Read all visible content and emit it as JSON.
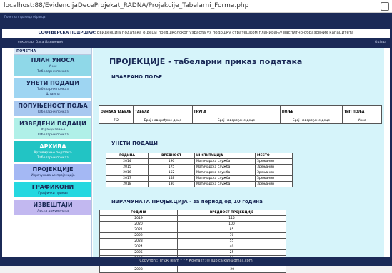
{
  "browser": {
    "url": "localhost:88/EvidencijaDeceProjekat_RADNA/Projekcije_Tabelarni_Forma.php"
  },
  "top": {
    "link": "Почетна страница обрасца"
  },
  "header": {
    "bold": "СОФТВЕРСКА ПОДРШКА:",
    "text": " Евиденција података о деци предшколског узраста уз подршку стратешком планирању васпитно-образовних капацитета"
  },
  "darkbar": {
    "user": "секретар: Олга Лазаревић",
    "logout": "Одјава"
  },
  "sidebar": {
    "home": "ПОЧЕТНА",
    "sections": [
      {
        "title": "ПЛАН УНОСА",
        "items": [
          "Унос",
          "Табеларни приказ"
        ]
      },
      {
        "title": "УНЕТИ ПОДАЦИ",
        "items": [
          "Табеларни приказ",
          "Штампа"
        ]
      },
      {
        "title": "ПОПУЊЕНОСТ ПОЉА",
        "items": [
          "Табеларни приказ"
        ]
      },
      {
        "title": "ИЗВЕДЕНИ ПОДАЦИ",
        "items": [
          "Израчунавање",
          "Табеларни приказ"
        ]
      },
      {
        "title": "АРХИВА",
        "items": [
          "Архивирање података",
          "Табеларни приказ"
        ]
      },
      {
        "title": "ПРОЈЕКЦИЈЕ",
        "items": [
          "Израчунавање пројекција"
        ]
      },
      {
        "title": "ГРАФИКОНИ",
        "items": [
          "Графички приказ"
        ]
      },
      {
        "title": "ИЗВЕШТАЈИ",
        "items": [
          "Листа докумената"
        ]
      }
    ]
  },
  "main": {
    "title": "ПРОЈЕКЦИЈЕ - табеларни приказ података",
    "selected_heading": "ИЗАБРАНО ПОЉЕ",
    "selected_table": {
      "headers": [
        "ОЗНАКА ТАБЕЛЕ",
        "ТАБЕЛА",
        "ГРУПА",
        "ПОЉЕ",
        "ТИП ПОЉА"
      ],
      "row": [
        "7.2",
        "Број новорођене деце",
        "Број новорођене деце",
        "Број новорођене деце",
        "Унос"
      ]
    },
    "entered_heading": "УНЕТИ ПОДАЦИ",
    "entered_table": {
      "headers": [
        "ГОДИНА",
        "ВРЕДНОСТ",
        "ИНСТИТУЦИЈА",
        "МЕСТО"
      ],
      "rows": [
        [
          "2014",
          "190",
          "Матичарска служба",
          "Зрењанин"
        ],
        [
          "2015",
          "175",
          "Матичарска служба",
          "Зрењанин"
        ],
        [
          "2016",
          "152",
          "Матичарска служба",
          "Зрењанин"
        ],
        [
          "2017",
          "148",
          "Матичарска служба",
          "Зрењанин"
        ],
        [
          "2018",
          "130",
          "Матичарска служба",
          "Зрењанин"
        ]
      ]
    },
    "projection_heading": "ИЗРАЧУНАТА ПРОЈЕКЦИЈА - за период од 10 година",
    "projection_table": {
      "headers": [
        "ГОДИНА",
        "ВРЕДНОСТ ПРОЈЕКЦИЈЕ"
      ],
      "rows": [
        [
          "2019",
          "115"
        ],
        [
          "2020",
          "100"
        ],
        [
          "2021",
          "85"
        ],
        [
          "2022",
          "70"
        ],
        [
          "2023",
          "55"
        ],
        [
          "2024",
          "40"
        ],
        [
          "2025",
          "25"
        ],
        [
          "2026",
          "10"
        ],
        [
          "2027",
          "-5"
        ],
        [
          "2028",
          "-20"
        ]
      ]
    }
  },
  "footer": {
    "text": "Copyright: TFZR Team * * * Контакт: ✉ ljubica.kan@gmail.com"
  }
}
